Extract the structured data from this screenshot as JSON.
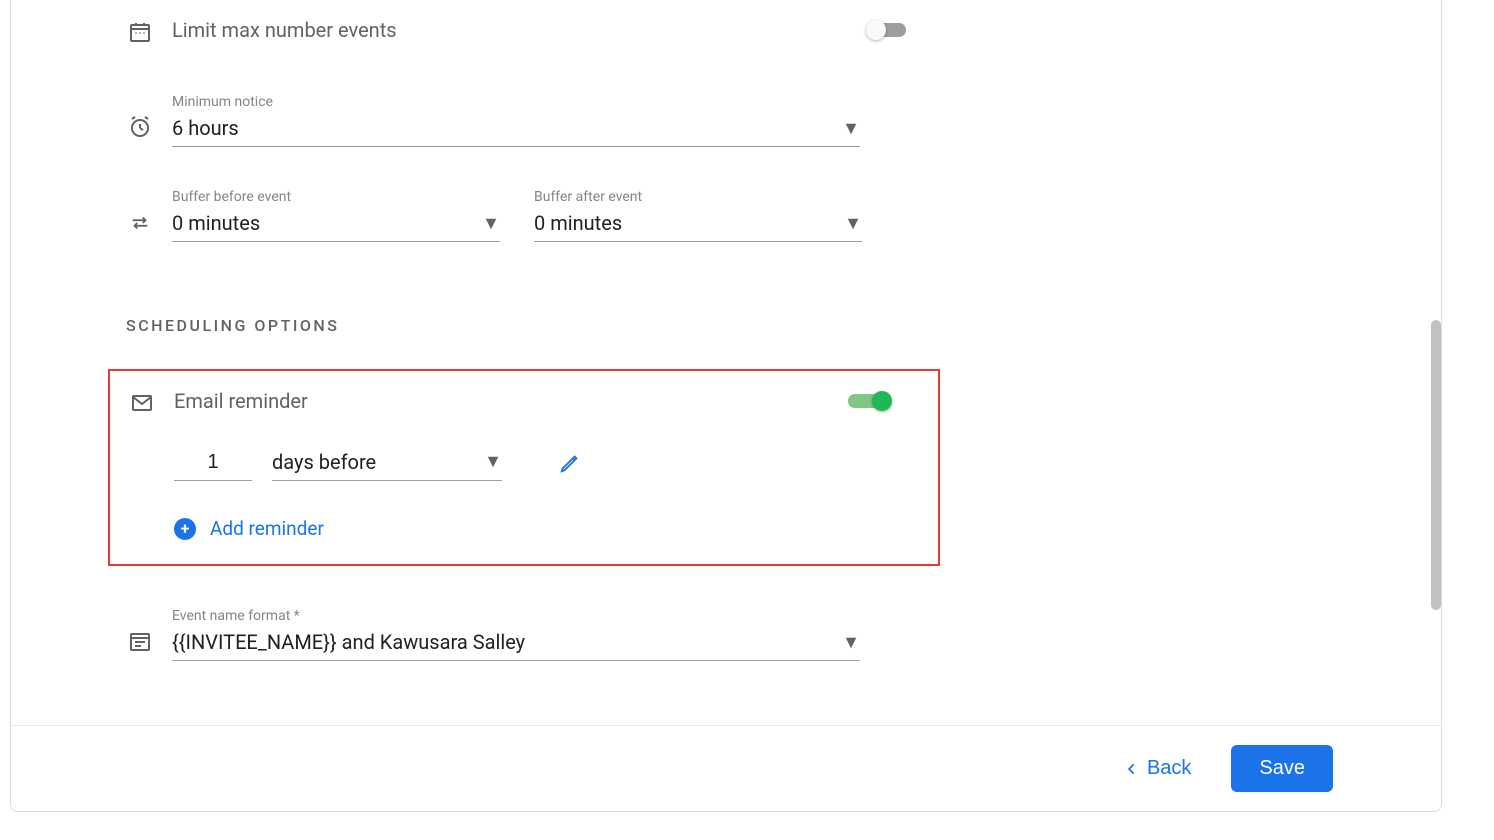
{
  "limit_max_events": {
    "label": "Limit max number events",
    "enabled": false
  },
  "minimum_notice": {
    "label": "Minimum notice",
    "value": "6 hours"
  },
  "buffer_before": {
    "label": "Buffer before event",
    "value": "0 minutes"
  },
  "buffer_after": {
    "label": "Buffer after event",
    "value": "0 minutes"
  },
  "section_heading": "SCHEDULING OPTIONS",
  "email_reminder": {
    "label": "Email reminder",
    "enabled": true,
    "amount": "1",
    "unit": "days before",
    "add_label": "Add reminder"
  },
  "event_name_format": {
    "label": "Event name format *",
    "value": "{{INVITEE_NAME}} and Kawusara Salley"
  },
  "footer": {
    "back": "Back",
    "save": "Save"
  }
}
